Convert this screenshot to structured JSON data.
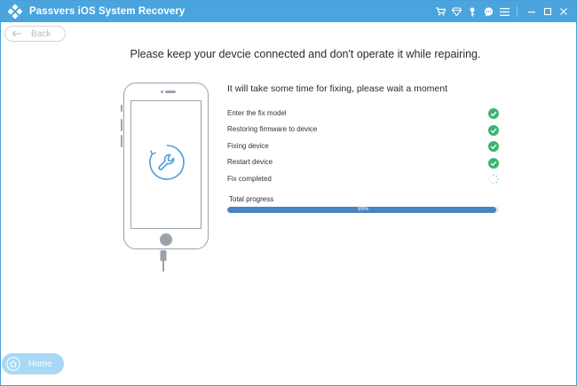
{
  "app": {
    "title": "Passvers iOS System Recovery"
  },
  "nav": {
    "back_label": "Back",
    "home_label": "Home"
  },
  "main": {
    "heading": "Please keep your devcie connected and don't operate it while repairing.",
    "wait_text": "It will take some time for fixing, please wait a moment",
    "steps": [
      {
        "label": "Enter the fix model",
        "status": "done"
      },
      {
        "label": "Restoring firmware to device",
        "status": "done"
      },
      {
        "label": "Fixing device",
        "status": "done"
      },
      {
        "label": "Restart device",
        "status": "done"
      },
      {
        "label": "Fix completed",
        "status": "in-progress"
      }
    ],
    "total_progress_label": "Total progress",
    "progress_percent": 99,
    "progress_text": "99%"
  },
  "icons": {
    "title_controls": [
      "cart-icon",
      "diamond-icon",
      "key-icon",
      "chat-icon",
      "menu-icon",
      "minimize-icon",
      "maximize-icon",
      "close-icon"
    ]
  },
  "colors": {
    "titlebar": "#4aa4de",
    "done": "#3cb46e",
    "progress": "#4a84c1",
    "home_button": "#a8d8f4"
  }
}
